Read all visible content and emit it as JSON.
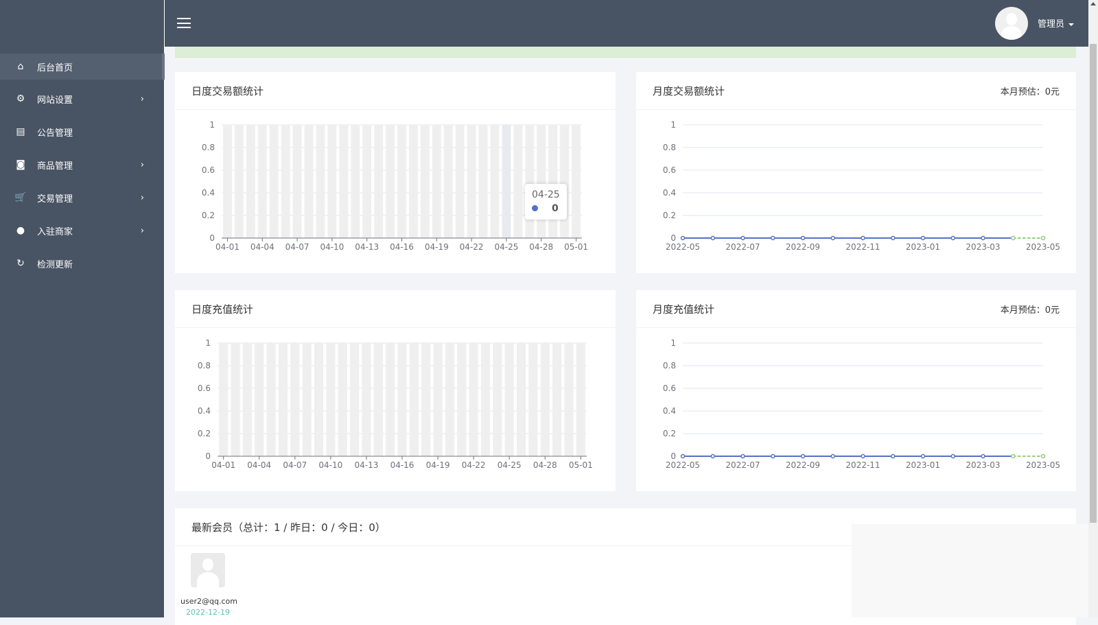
{
  "sidebar": {
    "items": [
      {
        "label": "后台首页",
        "icon": "home-icon",
        "glyph": "⌂",
        "chevron": false,
        "active": true
      },
      {
        "label": "网站设置",
        "icon": "gear-icon",
        "glyph": "⚙",
        "chevron": true
      },
      {
        "label": "公告管理",
        "icon": "news-icon",
        "glyph": "▤",
        "chevron": false
      },
      {
        "label": "商品管理",
        "icon": "shopping-bag-icon",
        "glyph": "◙",
        "chevron": true
      },
      {
        "label": "交易管理",
        "icon": "cart-icon",
        "glyph": "🛒",
        "chevron": true
      },
      {
        "label": "入驻商家",
        "icon": "user-icon",
        "glyph": "●",
        "chevron": true
      },
      {
        "label": "检测更新",
        "icon": "refresh-icon",
        "glyph": "↻",
        "chevron": false
      }
    ]
  },
  "header": {
    "user": "管理员"
  },
  "cards": {
    "daily_trade": {
      "title": "日度交易额统计"
    },
    "monthly_trade": {
      "title": "月度交易额统计",
      "estimate": "本月预估：0元"
    },
    "daily_recharge": {
      "title": "日度充值统计"
    },
    "monthly_recharge": {
      "title": "月度充值统计",
      "estimate": "本月预估：0元"
    }
  },
  "tooltip": {
    "label": "04-25",
    "value": "0"
  },
  "members": {
    "title": "最新会员（总计：1 / 昨日：0 / 今日：0）",
    "list": [
      {
        "email": "user2@qq.com",
        "date": "2022-12-19"
      }
    ]
  },
  "colors": {
    "series": "#5470c6",
    "forecast": "#91cc75",
    "bar_bg": "#efefef",
    "sidebar": "#485363"
  },
  "chart_data": [
    {
      "type": "bar",
      "title": "日度交易额统计",
      "categories": [
        "04-01",
        "04-02",
        "04-03",
        "04-04",
        "04-05",
        "04-06",
        "04-07",
        "04-08",
        "04-09",
        "04-10",
        "04-11",
        "04-12",
        "04-13",
        "04-14",
        "04-15",
        "04-16",
        "04-17",
        "04-18",
        "04-19",
        "04-20",
        "04-21",
        "04-22",
        "04-23",
        "04-24",
        "04-25",
        "04-26",
        "04-27",
        "04-28",
        "04-29",
        "04-30",
        "05-01"
      ],
      "values": [
        0,
        0,
        0,
        0,
        0,
        0,
        0,
        0,
        0,
        0,
        0,
        0,
        0,
        0,
        0,
        0,
        0,
        0,
        0,
        0,
        0,
        0,
        0,
        0,
        0,
        0,
        0,
        0,
        0,
        0,
        0
      ],
      "tick_every": 3,
      "ylim": [
        0,
        1
      ],
      "yticks": [
        "0",
        "0.2",
        "0.4",
        "0.6",
        "0.8",
        "1"
      ],
      "highlight": "04-25"
    },
    {
      "type": "line",
      "title": "月度交易额统计",
      "categories": [
        "2022-05",
        "2022-06",
        "2022-07",
        "2022-08",
        "2022-09",
        "2022-10",
        "2022-11",
        "2022-12",
        "2023-01",
        "2023-02",
        "2023-03",
        "2023-04",
        "2023-05"
      ],
      "values": [
        0,
        0,
        0,
        0,
        0,
        0,
        0,
        0,
        0,
        0,
        0,
        0,
        0
      ],
      "forecast_from": "2023-04",
      "tick_every": 2,
      "ylim": [
        0,
        1
      ],
      "yticks": [
        "0",
        "0.2",
        "0.4",
        "0.6",
        "0.8",
        "1"
      ]
    },
    {
      "type": "bar",
      "title": "日度充值统计",
      "categories": [
        "04-01",
        "04-02",
        "04-03",
        "04-04",
        "04-05",
        "04-06",
        "04-07",
        "04-08",
        "04-09",
        "04-10",
        "04-11",
        "04-12",
        "04-13",
        "04-14",
        "04-15",
        "04-16",
        "04-17",
        "04-18",
        "04-19",
        "04-20",
        "04-21",
        "04-22",
        "04-23",
        "04-24",
        "04-25",
        "04-26",
        "04-27",
        "04-28",
        "04-29",
        "04-30",
        "05-01"
      ],
      "values": [
        0,
        0,
        0,
        0,
        0,
        0,
        0,
        0,
        0,
        0,
        0,
        0,
        0,
        0,
        0,
        0,
        0,
        0,
        0,
        0,
        0,
        0,
        0,
        0,
        0,
        0,
        0,
        0,
        0,
        0,
        0
      ],
      "tick_every": 3,
      "ylim": [
        0,
        1
      ],
      "yticks": [
        "0",
        "0.2",
        "0.4",
        "0.6",
        "0.8",
        "1"
      ]
    },
    {
      "type": "line",
      "title": "月度充值统计",
      "categories": [
        "2022-05",
        "2022-06",
        "2022-07",
        "2022-08",
        "2022-09",
        "2022-10",
        "2022-11",
        "2022-12",
        "2023-01",
        "2023-02",
        "2023-03",
        "2023-04",
        "2023-05"
      ],
      "values": [
        0,
        0,
        0,
        0,
        0,
        0,
        0,
        0,
        0,
        0,
        0,
        0,
        0
      ],
      "forecast_from": "2023-04",
      "tick_every": 2,
      "ylim": [
        0,
        1
      ],
      "yticks": [
        "0",
        "0.2",
        "0.4",
        "0.6",
        "0.8",
        "1"
      ]
    }
  ]
}
